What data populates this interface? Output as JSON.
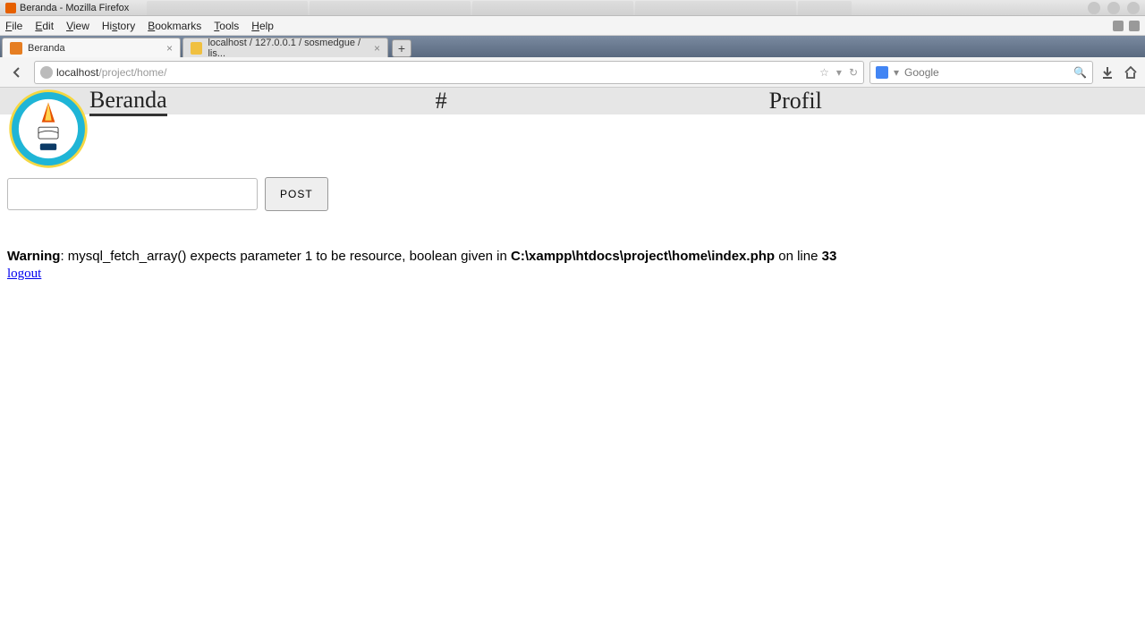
{
  "titlebar": {
    "text": "Beranda - Mozilla Firefox"
  },
  "menu": {
    "file": "File",
    "edit": "Edit",
    "view": "View",
    "history": "History",
    "bookmarks": "Bookmarks",
    "tools": "Tools",
    "help": "Help"
  },
  "tabs": [
    {
      "label": "Beranda"
    },
    {
      "label": "localhost / 127.0.0.1 / sosmedgue / lis..."
    }
  ],
  "newtab_glyph": "+",
  "url": {
    "host": "localhost",
    "path": "/project/home/"
  },
  "search": {
    "placeholder": "Google"
  },
  "nav": {
    "beranda": "Beranda",
    "hash": "#",
    "profil": "Profil"
  },
  "post_button": "POST",
  "warning": {
    "label": "Warning",
    "mid1": ": mysql_fetch_array() expects parameter 1 to be resource, boolean given in ",
    "file": "C:\\xampp\\htdocs\\project\\home\\index.php",
    "mid2": " on line ",
    "line": "33"
  },
  "logout": "logout"
}
